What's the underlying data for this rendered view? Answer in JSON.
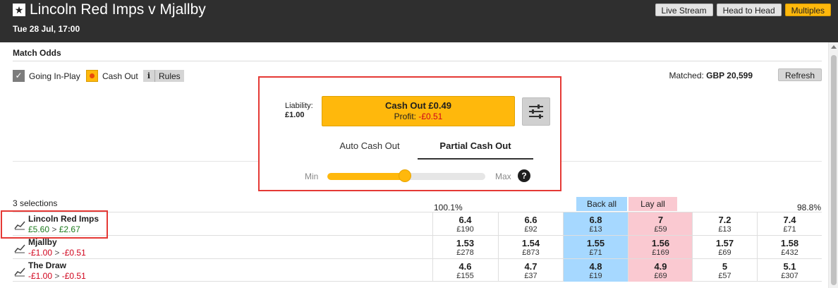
{
  "header": {
    "title": "Lincoln Red Imps v Mjallby",
    "date": "Tue 28 Jul, 17:00",
    "buttons": [
      "Live Stream",
      "Head to Head",
      "Multiples"
    ]
  },
  "market": {
    "title": "Match Odds",
    "going_in_play_label": "Going In-Play",
    "cash_out_label": "Cash Out",
    "rules_icon": "i",
    "rules_label": "Rules",
    "matched_label": "Matched:",
    "matched_value": "GBP 20,599",
    "refresh_label": "Refresh"
  },
  "cashout": {
    "liability_label": "Liability:",
    "liability_value": "£1.00",
    "button_label": "Cash Out £0.49",
    "profit_label": "Profit:",
    "profit_value": "-£0.51",
    "tabs": [
      "Auto Cash Out",
      "Partial Cash Out"
    ],
    "active_tab": "Partial Cash Out",
    "slider_min": "Min",
    "slider_max": "Max",
    "slider_fraction": 0.49,
    "help": "?"
  },
  "selections": {
    "count_label": "3 selections",
    "back_book": "100.1%",
    "lay_book": "98.8%",
    "back_all": "Back all",
    "lay_all": "Lay all",
    "rows": [
      {
        "name": "Lincoln Red Imps",
        "pnl_from": "£5.60",
        "pnl_to": "£2.67",
        "odds": [
          {
            "price": "6.4",
            "size": "£190"
          },
          {
            "price": "6.6",
            "size": "£92"
          },
          {
            "price": "6.8",
            "size": "£13"
          },
          {
            "price": "7",
            "size": "£59"
          },
          {
            "price": "7.2",
            "size": "£13"
          },
          {
            "price": "7.4",
            "size": "£71"
          }
        ]
      },
      {
        "name": "Mjallby",
        "pnl_from": "-£1.00",
        "pnl_to": "-£0.51",
        "odds": [
          {
            "price": "1.53",
            "size": "£278"
          },
          {
            "price": "1.54",
            "size": "£873"
          },
          {
            "price": "1.55",
            "size": "£71"
          },
          {
            "price": "1.56",
            "size": "£169"
          },
          {
            "price": "1.57",
            "size": "£69"
          },
          {
            "price": "1.58",
            "size": "£432"
          }
        ]
      },
      {
        "name": "The Draw",
        "pnl_from": "-£1.00",
        "pnl_to": "-£0.51",
        "odds": [
          {
            "price": "4.6",
            "size": "£155"
          },
          {
            "price": "4.7",
            "size": "£37"
          },
          {
            "price": "4.8",
            "size": "£19"
          },
          {
            "price": "4.9",
            "size": "£69"
          },
          {
            "price": "5",
            "size": "£57"
          },
          {
            "price": "5.1",
            "size": "£307"
          }
        ]
      }
    ]
  },
  "colors": {
    "accent": "#ffb80c",
    "back": "#a6d8ff",
    "lay": "#fac9d1",
    "header_bg": "#2f2f2f",
    "highlight": "#e53935"
  }
}
